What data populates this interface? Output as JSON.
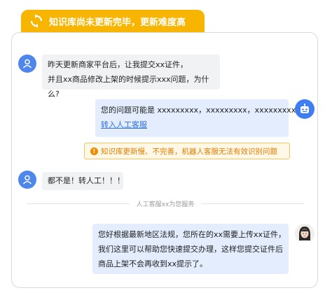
{
  "banner": {
    "text": "知识库尚未更新完毕，更新难度高",
    "icon": "refresh-icon"
  },
  "messages": {
    "user1": {
      "line1": "昨天更新商家平台后，让我提交xx证件，",
      "line2": "并且xx商品修改上架的时候提示xxx问题，为什么?"
    },
    "bot": {
      "line1": "您的问题可能是 xxxxxxxxx，xxxxxxxxx，xxxxxxxxx，",
      "link": "转入人工客服"
    },
    "warning": "知识库更新慢、不完善，机器人客服无法有效识别问题",
    "user2": "都不是！转人工！！！",
    "divider": "人工客服xx为您服务",
    "agent": {
      "line1": "您好根据最新地区法规，您所在的xx需要上传xx证件，",
      "line2": "我们这里可以帮助您快速提交办理，这样您提交证件后",
      "line3": "商品上架不会再收到xx提示了。"
    }
  },
  "colors": {
    "banner": "#f7b500",
    "user_avatar": "#4f86ec",
    "bot_avatar": "#3f7ef0",
    "right_bubble": "#e3edfd",
    "warning_text": "#e07d00"
  }
}
